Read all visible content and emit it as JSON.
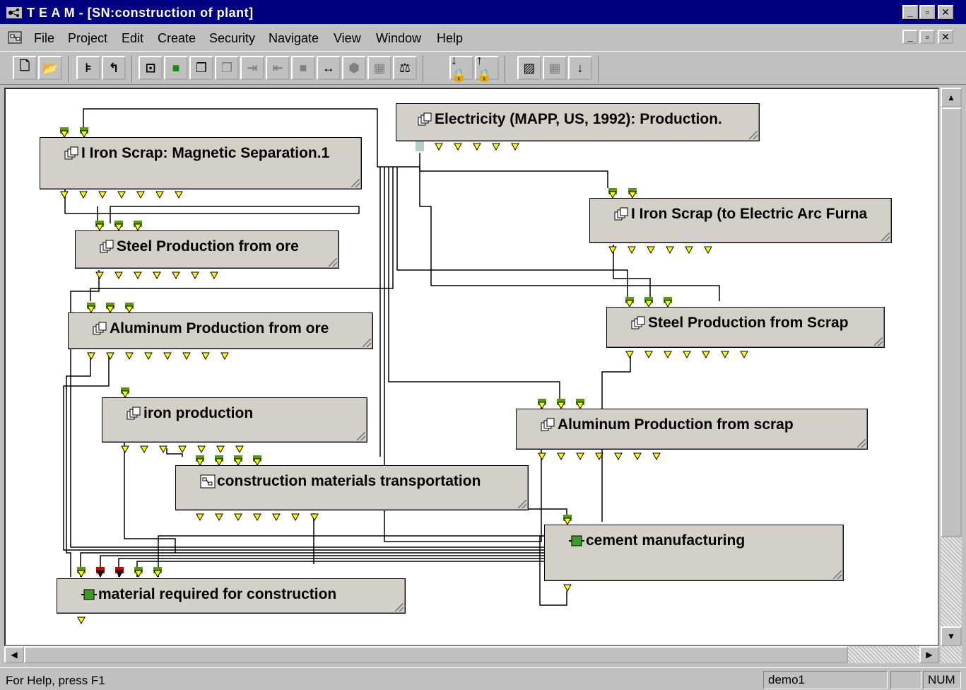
{
  "window": {
    "title": "T E A M - [SN:construction of plant]"
  },
  "menu": {
    "items": [
      {
        "label": "File"
      },
      {
        "label": "Project"
      },
      {
        "label": "Edit"
      },
      {
        "label": "Create"
      },
      {
        "label": "Security"
      },
      {
        "label": "Navigate"
      },
      {
        "label": "View"
      },
      {
        "label": "Window"
      },
      {
        "label": "Help"
      }
    ]
  },
  "toolbar": {
    "buttons": [
      "new-icon",
      "open-icon",
      "tree-icon",
      "back-arrow-icon",
      "module-icon",
      "green-module-icon",
      "stack-icon",
      "stack-disabled-icon",
      "input-arrow-icon",
      "output-arrow-icon",
      "block-icon",
      "span-icon",
      "hex-icon",
      "calculator-icon",
      "balance-icon",
      "lock-down-icon",
      "lock-up-icon",
      "chart-icon",
      "grid-icon",
      "down-arrow-icon"
    ]
  },
  "nodes": [
    {
      "id": "electricity",
      "label": "Electricity (MAPP, US, 1992): Production.",
      "icon": "stack-icon"
    },
    {
      "id": "iron-scrap-mag",
      "label": "I Iron Scrap: Magnetic Separation.1",
      "icon": "stack-icon"
    },
    {
      "id": "iron-scrap-eaf",
      "label": "I Iron Scrap (to Electric Arc Furna",
      "icon": "stack-icon"
    },
    {
      "id": "steel-ore",
      "label": "Steel Production from ore",
      "icon": "stack-icon"
    },
    {
      "id": "steel-scrap",
      "label": "Steel Production from Scrap",
      "icon": "stack-icon"
    },
    {
      "id": "alu-ore",
      "label": "Aluminum Production from ore",
      "icon": "stack-icon"
    },
    {
      "id": "iron-prod",
      "label": "iron production",
      "icon": "stack-icon"
    },
    {
      "id": "alu-scrap",
      "label": "Aluminum Production from scrap",
      "icon": "stack-icon"
    },
    {
      "id": "transport",
      "label": "construction materials transportation",
      "icon": "module-icon"
    },
    {
      "id": "cement",
      "label": "cement manufacturing",
      "icon": "green-module-icon"
    },
    {
      "id": "material",
      "label": "material required for construction",
      "icon": "green-module-icon"
    }
  ],
  "colors": {
    "port_arrow": "#ffff00",
    "port_green": "#5a9a10",
    "port_red": "#cc0000",
    "titlebar": "#000080"
  },
  "status": {
    "help": "For Help, press F1",
    "user": "demo1",
    "num": "NUM"
  }
}
